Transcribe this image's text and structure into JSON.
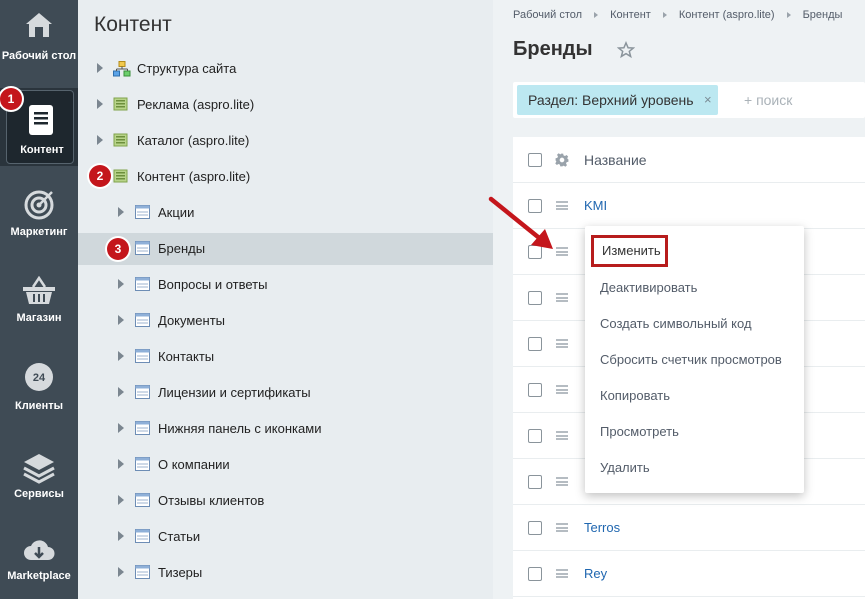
{
  "rail": {
    "items": [
      {
        "label": "Рабочий стол",
        "icon": "home-icon"
      },
      {
        "label": "Контент",
        "icon": "document-icon",
        "active": true
      },
      {
        "label": "Маркетинг",
        "icon": "target-icon"
      },
      {
        "label": "Магазин",
        "icon": "basket-icon"
      },
      {
        "label": "Клиенты",
        "icon": "clock-24-icon"
      },
      {
        "label": "Сервисы",
        "icon": "layers-icon"
      },
      {
        "label": "Marketplace",
        "icon": "cloud-download-icon"
      }
    ],
    "badge": "1"
  },
  "tree": {
    "title": "Контент",
    "items": [
      {
        "label": "Структура сайта",
        "level": 0,
        "icon": "site-structure-icon"
      },
      {
        "label": "Реклама (aspro.lite)",
        "level": 0,
        "icon": "folder-green-icon"
      },
      {
        "label": "Каталог (aspro.lite)",
        "level": 0,
        "icon": "folder-green-icon"
      },
      {
        "label": "Контент (aspro.lite)",
        "level": 0,
        "icon": "folder-green-icon",
        "badge": "2"
      },
      {
        "label": "Акции",
        "level": 1,
        "icon": "table-icon"
      },
      {
        "label": "Бренды",
        "level": 1,
        "icon": "table-icon",
        "selected": true,
        "badge": "3"
      },
      {
        "label": "Вопросы и ответы",
        "level": 1,
        "icon": "table-icon"
      },
      {
        "label": "Документы",
        "level": 1,
        "icon": "table-icon"
      },
      {
        "label": "Контакты",
        "level": 1,
        "icon": "table-icon"
      },
      {
        "label": "Лицензии и сертификаты",
        "level": 1,
        "icon": "table-icon"
      },
      {
        "label": "Нижняя панель с иконками",
        "level": 1,
        "icon": "table-icon"
      },
      {
        "label": "О компании",
        "level": 1,
        "icon": "table-icon"
      },
      {
        "label": "Отзывы клиентов",
        "level": 1,
        "icon": "table-icon"
      },
      {
        "label": "Статьи",
        "level": 1,
        "icon": "table-icon"
      },
      {
        "label": "Тизеры",
        "level": 1,
        "icon": "table-icon"
      }
    ]
  },
  "breadcrumbs": [
    "Рабочий стол",
    "Контент",
    "Контент (aspro.lite)",
    "Бренды"
  ],
  "page": {
    "title": "Бренды"
  },
  "filter": {
    "chip": "Раздел: Верхний уровень",
    "chip_close": "×",
    "search_placeholder": "+ поиск"
  },
  "grid": {
    "header": "Название",
    "rows": [
      "KMI",
      "",
      "",
      "",
      "",
      "",
      "",
      "Terros",
      "Rey"
    ]
  },
  "context_menu": {
    "items": [
      "Изменить",
      "Деактивировать",
      "Создать символьный код",
      "Сбросить счетчик просмотров",
      "Копировать",
      "Просмотреть",
      "Удалить"
    ]
  },
  "colors": {
    "rail_bg": "#3f4b55",
    "badge": "#c4161c",
    "chip": "#bce8f1",
    "link": "#2067b0",
    "highlight_border": "#b71c1c"
  }
}
